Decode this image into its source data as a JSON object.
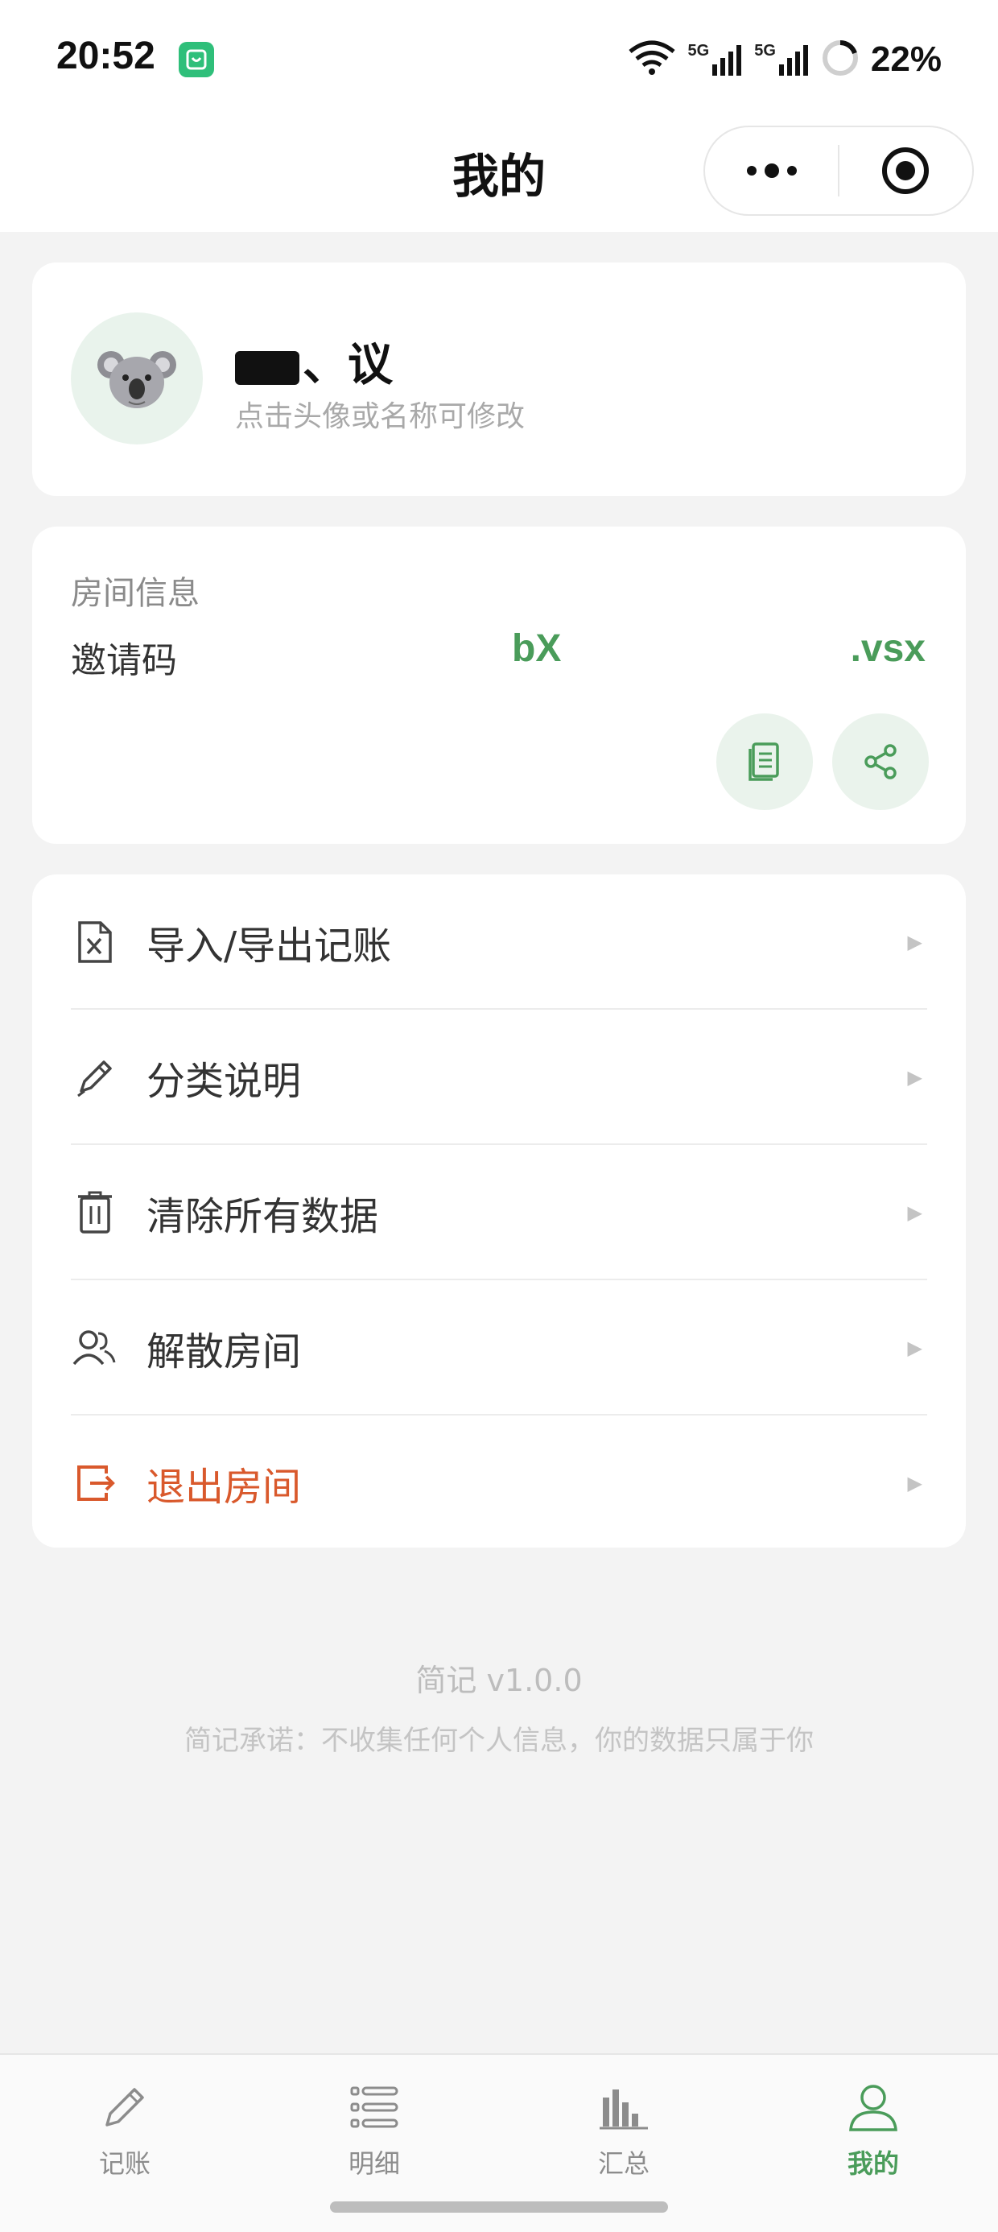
{
  "status_bar": {
    "time": "20:52",
    "battery_text": "22%",
    "network_5g_1": "5G",
    "network_5g_2": "5G"
  },
  "header": {
    "title": "我的"
  },
  "profile": {
    "name_visible": "、议",
    "hint": "点击头像或名称可修改"
  },
  "room": {
    "title": "房间信息",
    "invite_label": "邀请码",
    "invite_code_start": "bX",
    "invite_code_end": ".vsx"
  },
  "menu": {
    "items": [
      {
        "label": "导入/导出记账",
        "icon": "excel-file-icon"
      },
      {
        "label": "分类说明",
        "icon": "pencil-icon"
      },
      {
        "label": "清除所有数据",
        "icon": "trash-icon"
      },
      {
        "label": "解散房间",
        "icon": "users-icon"
      },
      {
        "label": "退出房间",
        "icon": "exit-icon"
      }
    ],
    "arrow": "▶"
  },
  "footer": {
    "version": "简记 v1.0.0",
    "promise": "简记承诺：不收集任何个人信息，你的数据只属于你"
  },
  "tabs": [
    {
      "label": "记账",
      "icon": "pencil-icon"
    },
    {
      "label": "明细",
      "icon": "list-icon"
    },
    {
      "label": "汇总",
      "icon": "bar-chart-icon"
    },
    {
      "label": "我的",
      "icon": "user-icon",
      "active": true
    }
  ],
  "colors": {
    "accent": "#4a9c5a",
    "danger": "#d9592c",
    "background": "#f3f3f3"
  }
}
